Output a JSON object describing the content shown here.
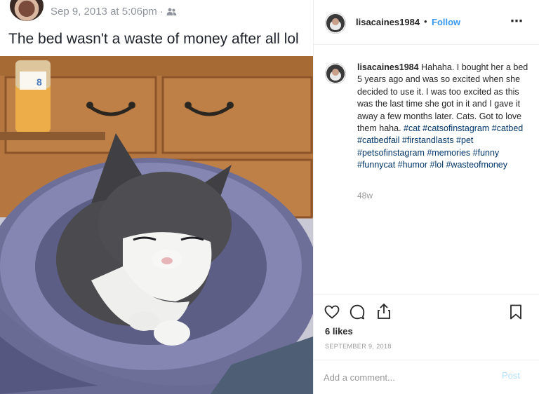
{
  "facebook_post": {
    "timestamp": "Sep 9, 2013 at 5:06pm",
    "separator": "·",
    "audience_icon": "friends-icon",
    "caption": "The bed wasn't a waste of money after all lol"
  },
  "photo": {
    "bottle_label": "8"
  },
  "instagram_post": {
    "username": "lisacaines1984",
    "dot": "•",
    "follow_label": "Follow",
    "more_icon": "more-options-icon",
    "comment": {
      "username": "lisacaines1984",
      "text": " Hahaha. I bought her a bed 5 years ago and was so excited when she decided to use it. I was too excited as this was the last time she got in it and I gave it away a few months later. Cats. Got to love them haha. ",
      "hashtags": "#cat #catsofinstagram #catbed #catbedfail #firstandlasts #pet #petsofinstagram #memories #funny #funnycat #humor #lol #wasteofmoney"
    },
    "age": "48w",
    "likes": "6 likes",
    "date": "SEPTEMBER 9, 2018",
    "add_comment_placeholder": "Add a comment...",
    "post_label": "Post"
  },
  "colors": {
    "link_blue": "#3897f0",
    "hashtag_blue": "#003569",
    "muted_gray": "#999999",
    "post_disabled": "#b2dffc"
  }
}
